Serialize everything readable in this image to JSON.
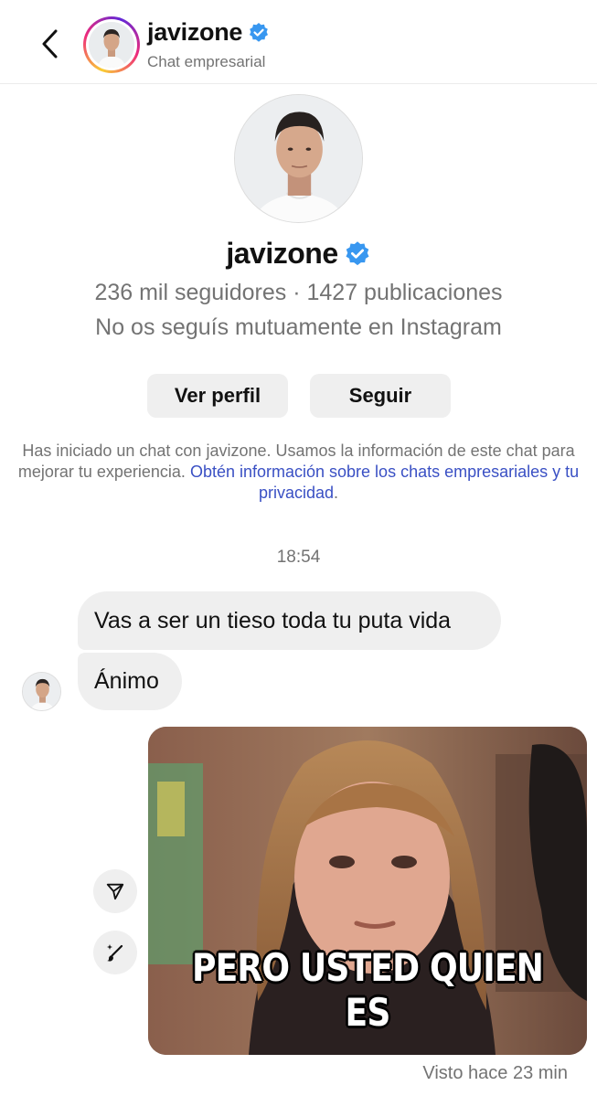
{
  "header": {
    "back_icon": "chevron-left-icon",
    "username": "javizone",
    "verified_icon": "verified-badge-icon",
    "subtitle": "Chat empresarial",
    "ring_colors": [
      "#f9ce34",
      "#ee2a7b",
      "#6228d7"
    ]
  },
  "profile": {
    "username": "javizone",
    "stats": "236 mil seguidores · 1427 publicaciones",
    "mutual": "No os seguís mutuamente en Instagram",
    "view_profile_label": "Ver perfil",
    "follow_label": "Seguir"
  },
  "info": {
    "text": "Has iniciado un chat con javizone. Usamos la información de este chat para mejorar tu experiencia.",
    "link": "Obtén información sobre los chats empresariales y tu privacidad",
    "trailing": "."
  },
  "conversation": {
    "timestamp": "18:54",
    "messages": [
      {
        "sender": "javizone",
        "text": "Vas a ser un tieso toda tu puta vida"
      },
      {
        "sender": "javizone",
        "text": "Ánimo"
      }
    ],
    "image_message": {
      "caption": "PERO USTED QUIEN ES"
    },
    "seen_status": "Visto hace 23 min"
  },
  "side_actions": {
    "share_icon": "share-send-icon",
    "edit_icon": "magic-brush-icon"
  },
  "colors": {
    "verified": "#3897f0",
    "link": "#3a50c4",
    "bubble": "#efefef",
    "muted_text": "#737373"
  }
}
